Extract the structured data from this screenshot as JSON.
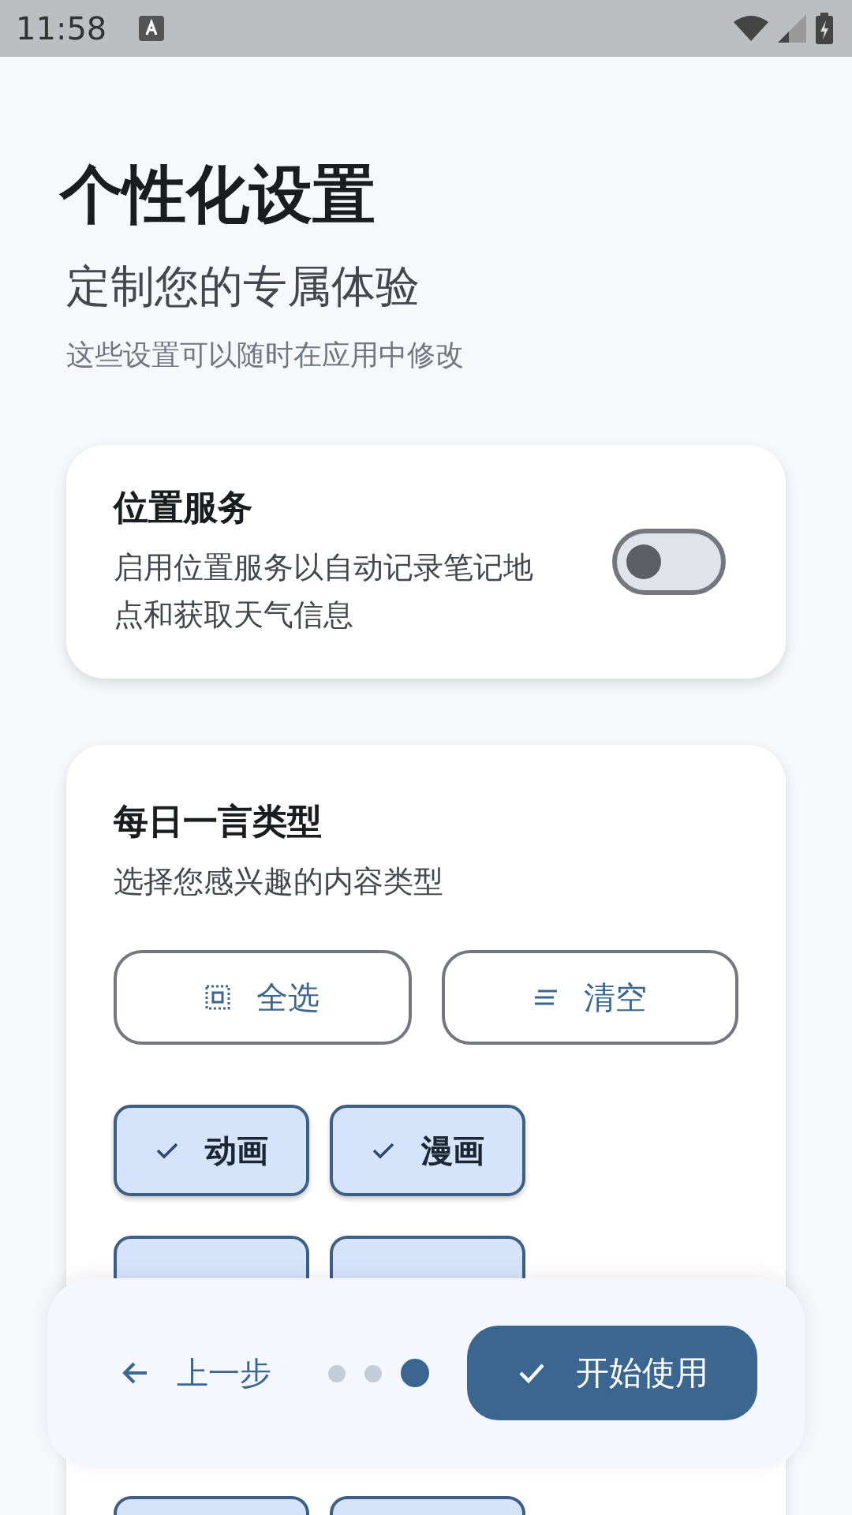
{
  "status_bar": {
    "time": "11:58"
  },
  "header": {
    "title": "个性化设置",
    "subtitle": "定制您的专属体验",
    "note": "这些设置可以随时在应用中修改"
  },
  "location_card": {
    "title": "位置服务",
    "description": "启用位置服务以自动记录笔记地点和获取天气信息",
    "on": false
  },
  "quote_card": {
    "title": "每日一言类型",
    "description": "选择您感兴趣的内容类型",
    "actions": [
      {
        "kind": "select-all",
        "label": "全选"
      },
      {
        "kind": "clear",
        "label": "清空"
      }
    ],
    "chips": [
      {
        "label": "动画",
        "selected": true
      },
      {
        "label": "漫画",
        "selected": true
      },
      {
        "selected": true
      },
      {
        "selected": true
      },
      {
        "selected": true
      },
      {
        "selected": true
      }
    ]
  },
  "footer": {
    "back": "上一步",
    "steps": [
      {
        "selected": false
      },
      {
        "selected": false
      },
      {
        "selected": true
      }
    ],
    "primary": "开始使用"
  }
}
